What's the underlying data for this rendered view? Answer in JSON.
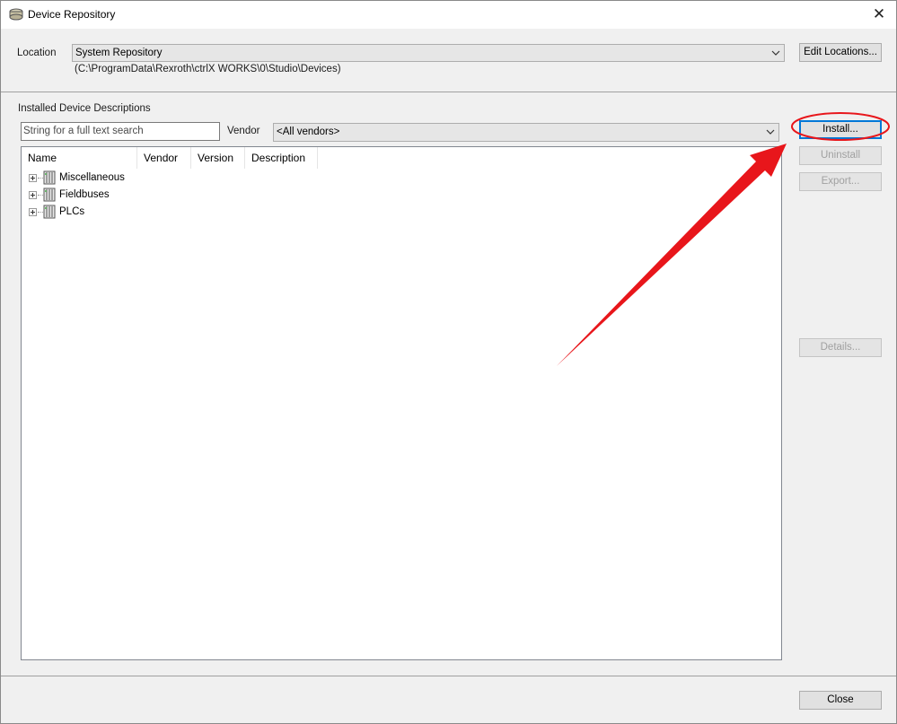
{
  "window": {
    "title": "Device Repository",
    "close_glyph": "✕"
  },
  "location": {
    "label": "Location",
    "selected": "System Repository",
    "path": "(C:\\ProgramData\\Rexroth\\ctrlX WORKS\\0\\Studio\\Devices)",
    "edit_button": "Edit Locations..."
  },
  "installed": {
    "section_label": "Installed Device Descriptions",
    "search_placeholder": "String for a full text search",
    "vendor_label": "Vendor",
    "vendor_selected": "<All vendors>"
  },
  "columns": [
    "Name",
    "Vendor",
    "Version",
    "Description"
  ],
  "tree": [
    {
      "label": "Miscellaneous",
      "icon": "device-icon"
    },
    {
      "label": "Fieldbuses",
      "icon": "device-icon"
    },
    {
      "label": "PLCs",
      "icon": "device-icon"
    }
  ],
  "buttons": {
    "install": "Install...",
    "uninstall": "Uninstall",
    "export": "Export...",
    "details": "Details...",
    "close": "Close"
  },
  "annotation": {
    "color": "#e8161b",
    "shapes": [
      "ellipse-highlight",
      "arrow"
    ]
  }
}
